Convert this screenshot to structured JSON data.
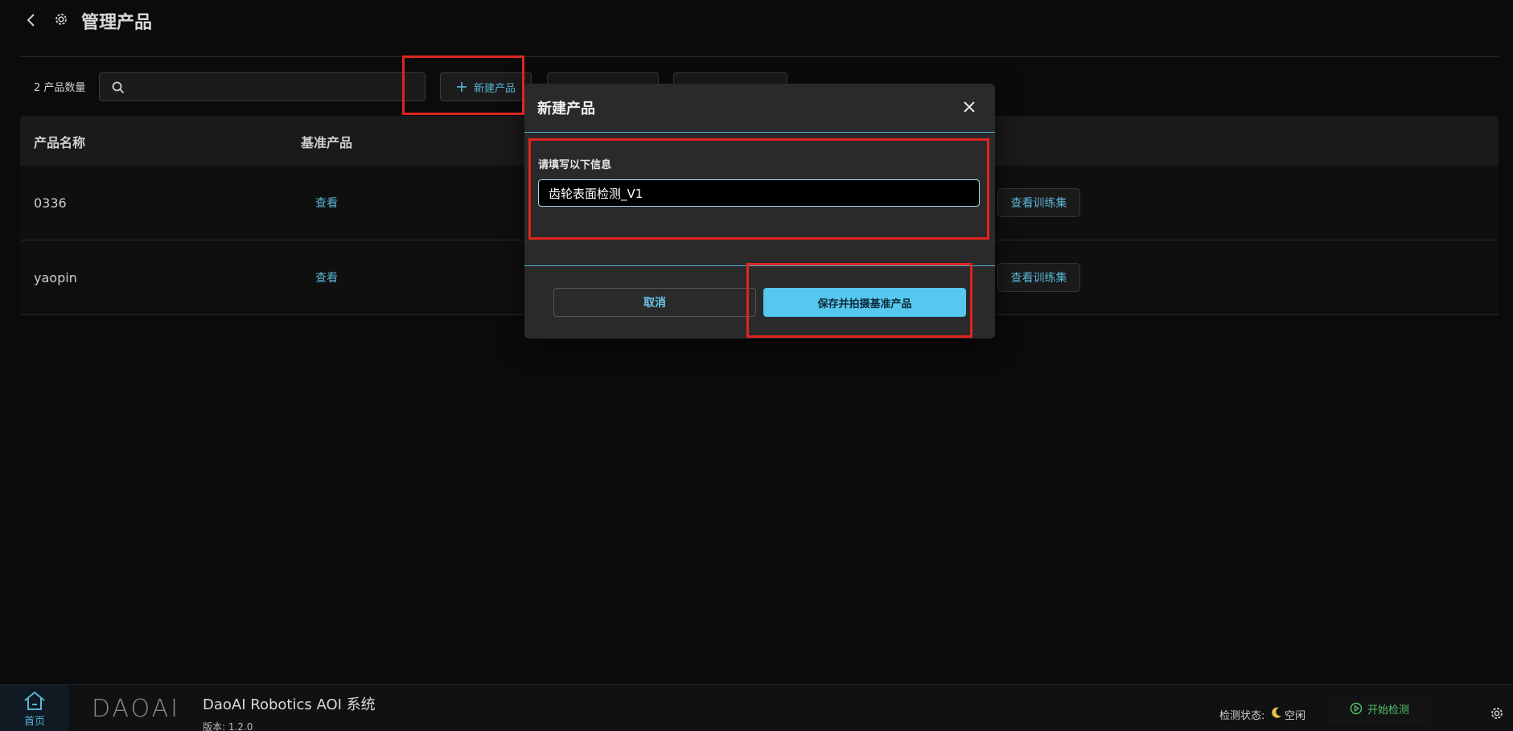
{
  "header": {
    "title": "管理产品"
  },
  "toolbar": {
    "count_label": "2 产品数量",
    "search_placeholder": "",
    "new_product_label": "新建产品",
    "tool2_label": "",
    "tool3_label": ""
  },
  "table": {
    "columns": [
      "产品名称",
      "基准产品"
    ],
    "rows": [
      {
        "name": "0336",
        "reference_link": "查看",
        "training_button": "查看训练集"
      },
      {
        "name": "yaopin",
        "reference_link": "查看",
        "training_button": "查看训练集"
      }
    ]
  },
  "modal": {
    "title": "新建产品",
    "form_label": "请填写以下信息",
    "name_value": "齿轮表面检测_V1",
    "cancel_label": "取消",
    "save_label": "保存并拍摄基准产品"
  },
  "footer": {
    "home_label": "首页",
    "logo_text": "DAOAI",
    "app_title": "DaoAI Robotics AOI 系统",
    "version": "版本: 1.2.0",
    "status_label": "检测状态:",
    "status_value": "空闲",
    "start_label": "开始检测"
  },
  "colors": {
    "accent": "#56c8ef",
    "link": "#5ab4d6",
    "highlight": "#e0241f",
    "success": "#4fc36a"
  },
  "icons": {
    "back": "chevron-left-icon",
    "settings_small": "gear-icon",
    "search": "search-icon",
    "add": "plus-icon",
    "close": "close-icon",
    "home": "home-icon",
    "moon": "moon-icon",
    "play": "play-circle-icon",
    "settings": "gear-icon"
  }
}
